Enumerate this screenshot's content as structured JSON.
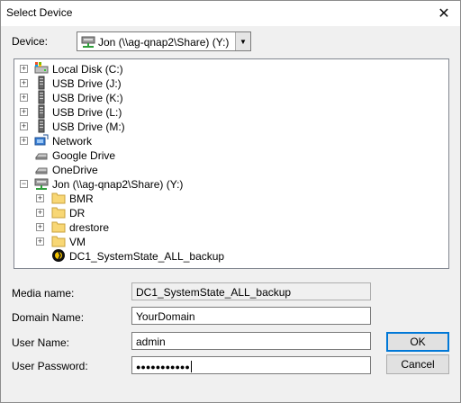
{
  "window": {
    "title": "Select Device",
    "close_glyph": "✕"
  },
  "device": {
    "label": "Device:",
    "selected": "Jon (\\\\ag-qnap2\\Share) (Y:)",
    "icon": "network-drive-icon"
  },
  "tree": {
    "items": [
      {
        "label": "Local Disk (C:)",
        "icon": "local-disk-icon",
        "expander": "+"
      },
      {
        "label": "USB Drive (J:)",
        "icon": "usb-drive-icon",
        "expander": "+"
      },
      {
        "label": "USB Drive (K:)",
        "icon": "usb-drive-icon",
        "expander": "+"
      },
      {
        "label": "USB Drive (L:)",
        "icon": "usb-drive-icon",
        "expander": "+"
      },
      {
        "label": "USB Drive (M:)",
        "icon": "usb-drive-icon",
        "expander": "+"
      },
      {
        "label": "Network",
        "icon": "network-icon",
        "expander": "+"
      },
      {
        "label": "Google Drive",
        "icon": "cloud-drive-icon",
        "expander": ""
      },
      {
        "label": "OneDrive",
        "icon": "cloud-drive-icon",
        "expander": ""
      },
      {
        "label": "Jon (\\\\ag-qnap2\\Share) (Y:)",
        "icon": "network-drive-icon",
        "expander": "−"
      },
      {
        "label": "BMR",
        "icon": "folder-icon",
        "expander": "+"
      },
      {
        "label": "DR",
        "icon": "folder-icon",
        "expander": "+"
      },
      {
        "label": "drestore",
        "icon": "folder-icon",
        "expander": "+"
      },
      {
        "label": "VM",
        "icon": "folder-icon",
        "expander": "+"
      },
      {
        "label": "DC1_SystemState_ALL_backup",
        "icon": "backup-icon",
        "expander": ""
      }
    ]
  },
  "form": {
    "media_name": {
      "label": "Media name:",
      "value": "DC1_SystemState_ALL_backup"
    },
    "domain_name": {
      "label": "Domain Name:",
      "value": "YourDomain"
    },
    "user_name": {
      "label": "User Name:",
      "value": "admin"
    },
    "user_password": {
      "label": "User Password:",
      "value": "●●●●●●●●●●●"
    }
  },
  "buttons": {
    "ok": "OK",
    "cancel": "Cancel"
  },
  "colors": {
    "folder": "#f8d775",
    "default_button_border": "#0078d7",
    "network_green": "#2e9e3a"
  }
}
